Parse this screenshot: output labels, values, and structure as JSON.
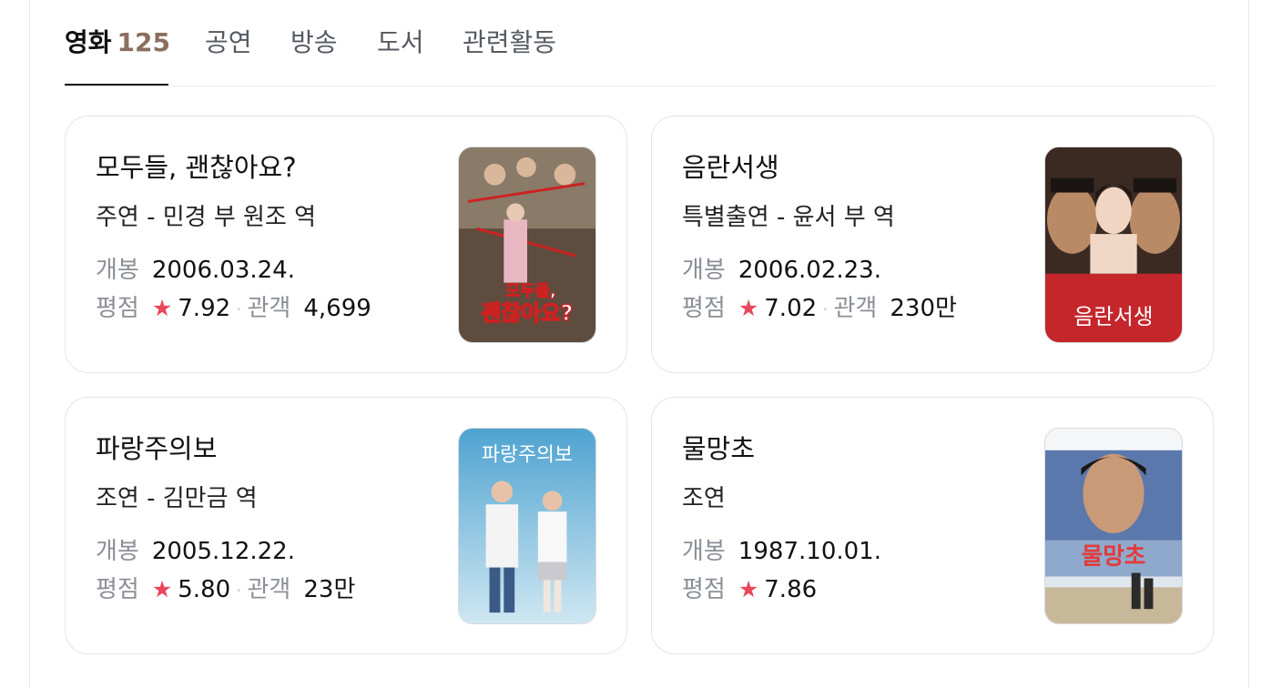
{
  "tabs": [
    {
      "label": "영화",
      "count": "125",
      "active": true
    },
    {
      "label": "공연"
    },
    {
      "label": "방송"
    },
    {
      "label": "도서"
    },
    {
      "label": "관련활동"
    }
  ],
  "labels": {
    "release": "개봉",
    "rating": "평점",
    "audience": "관객",
    "star": "★",
    "dot": "·"
  },
  "movies": [
    {
      "title": "모두들, 괜찮아요?",
      "role": "주연 - 민경 부 원조 역",
      "release": "2006.03.24.",
      "rating": "7.92",
      "audience": "4,699",
      "poster_text": "모두들, 괜찮아요?",
      "poster_colors": [
        "#6b5a4a",
        "#c23a3a"
      ]
    },
    {
      "title": "음란서생",
      "role": "특별출연 - 윤서 부 역",
      "release": "2006.02.23.",
      "rating": "7.02",
      "audience": "230만",
      "poster_text": "음란서생",
      "poster_colors": [
        "#c8252a",
        "#7a1414"
      ]
    },
    {
      "title": "파랑주의보",
      "role": "조연 - 김만금 역",
      "release": "2005.12.22.",
      "rating": "5.80",
      "audience": "23만",
      "poster_text": "파랑주의보",
      "poster_colors": [
        "#6fb3d6",
        "#e8f3f8"
      ]
    },
    {
      "title": "물망초",
      "role": "조연",
      "release": "1987.10.01.",
      "rating": "7.86",
      "audience": null,
      "poster_text": "물망초",
      "poster_colors": [
        "#4f6fa8",
        "#d94848"
      ]
    }
  ]
}
